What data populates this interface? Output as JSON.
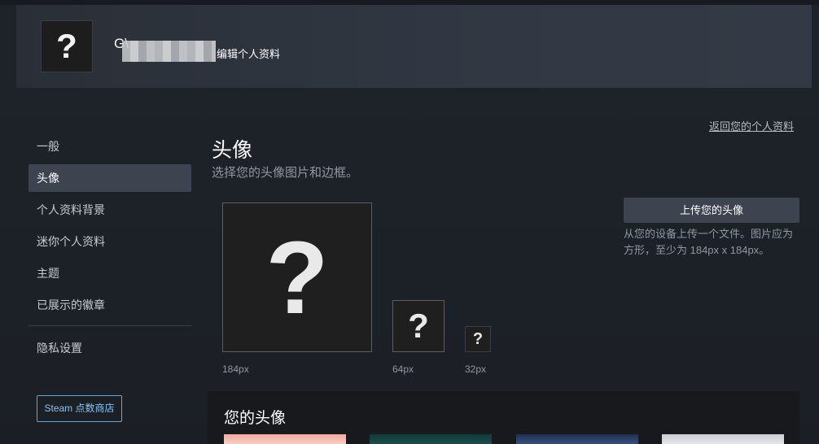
{
  "header": {
    "avatar_glyph": "?",
    "persona_name": "G\\",
    "edit_label": "编辑个人资料"
  },
  "back_link": "返回您的个人资料",
  "sidebar": {
    "items": [
      {
        "label": "一般",
        "active": false
      },
      {
        "label": "头像",
        "active": true
      },
      {
        "label": "个人资料背景",
        "active": false
      },
      {
        "label": "迷你个人资料",
        "active": false
      },
      {
        "label": "主题",
        "active": false
      },
      {
        "label": "已展示的徽章",
        "active": false
      }
    ],
    "privacy_label": "隐私设置",
    "store_button": "Steam 点数商店"
  },
  "main": {
    "title": "头像",
    "subtitle": "选择您的头像图片和边框。",
    "previews": [
      {
        "glyph": "?",
        "size_label": "184px"
      },
      {
        "glyph": "?",
        "size_label": "64px"
      },
      {
        "glyph": "?",
        "size_label": "32px"
      }
    ],
    "upload_button": "上传您的头像",
    "upload_desc": "从您的设备上传一个文件。图片应为方形，至少为 184px x 184px。",
    "your_avatars_title": "您的头像"
  },
  "colors": {
    "background": "#1d2229",
    "accent_link": "#8dc2ef",
    "active_item": "#3d4450"
  }
}
